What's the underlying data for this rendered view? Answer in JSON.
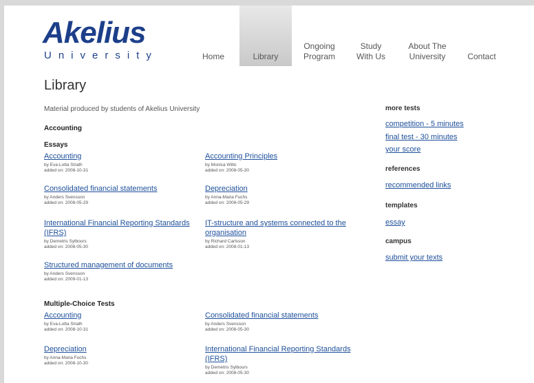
{
  "logo": {
    "main": "Akelius",
    "sub": "University"
  },
  "nav": [
    {
      "label": "Home"
    },
    {
      "label": "Library"
    },
    {
      "label": "Ongoing Program"
    },
    {
      "label": "Study With Us"
    },
    {
      "label": "About The University"
    },
    {
      "label": "Contact"
    }
  ],
  "page_title": "Library",
  "intro": "Material produced by students of Akelius University",
  "section_title": "Accounting",
  "essays": {
    "title": "Essays",
    "items": [
      {
        "title": "Accounting",
        "author": "by Eva-Lotta Strath",
        "added": "added on: 2008-10-31"
      },
      {
        "title": "Accounting Principles",
        "author": "by Monica Willo",
        "added": "added on: 2008-05-30"
      },
      {
        "title": "Consolidated financial statements",
        "author": "by Anders Svensson",
        "added": "added on: 2008-05-29"
      },
      {
        "title": "Depreciation",
        "author": "by Anna-Maria Fuchs",
        "added": "added on: 2008-05-29"
      },
      {
        "title": "International Financial Reporting Standards (IFRS)",
        "author": "by Demetris Sylbours",
        "added": "added on: 2008-05-30"
      },
      {
        "title": "IT-structure and systems connected to the organisation",
        "author": "by Richard Carlsson",
        "added": "added on: 2008-01-13"
      },
      {
        "title": "Structured management of documents",
        "author": "by Anders Svensson",
        "added": "added on: 2009-01-13"
      }
    ]
  },
  "mc_tests": {
    "title": "Multiple-Choice Tests",
    "items": [
      {
        "title": "Accounting",
        "author": "by Eva-Lotta Strath",
        "added": "added on: 2008-10-31"
      },
      {
        "title": "Consolidated financial statements",
        "author": "by Anders Svensson",
        "added": "added on: 2008-05-30"
      },
      {
        "title": "Depreciation",
        "author": "by Anna-Maria Fuchs",
        "added": "added on: 2008-10-30"
      },
      {
        "title": "International Financial Reporting Standards (IFRS)",
        "author": "by Demetris Sylbours",
        "added": "added on: 2008-05-30"
      }
    ]
  },
  "sidebar": {
    "more_tests": {
      "title": "more tests",
      "links": [
        "competition - 5 minutes",
        "final test - 30 minutes",
        "your score"
      ]
    },
    "references": {
      "title": "references",
      "links": [
        "recommended links"
      ]
    },
    "templates": {
      "title": "templates",
      "links": [
        "essay"
      ]
    },
    "campus": {
      "title": "campus",
      "links": [
        "submit your texts"
      ]
    }
  },
  "colors": {
    "brand": "#1d3f8a",
    "link": "#1d4f9a"
  }
}
